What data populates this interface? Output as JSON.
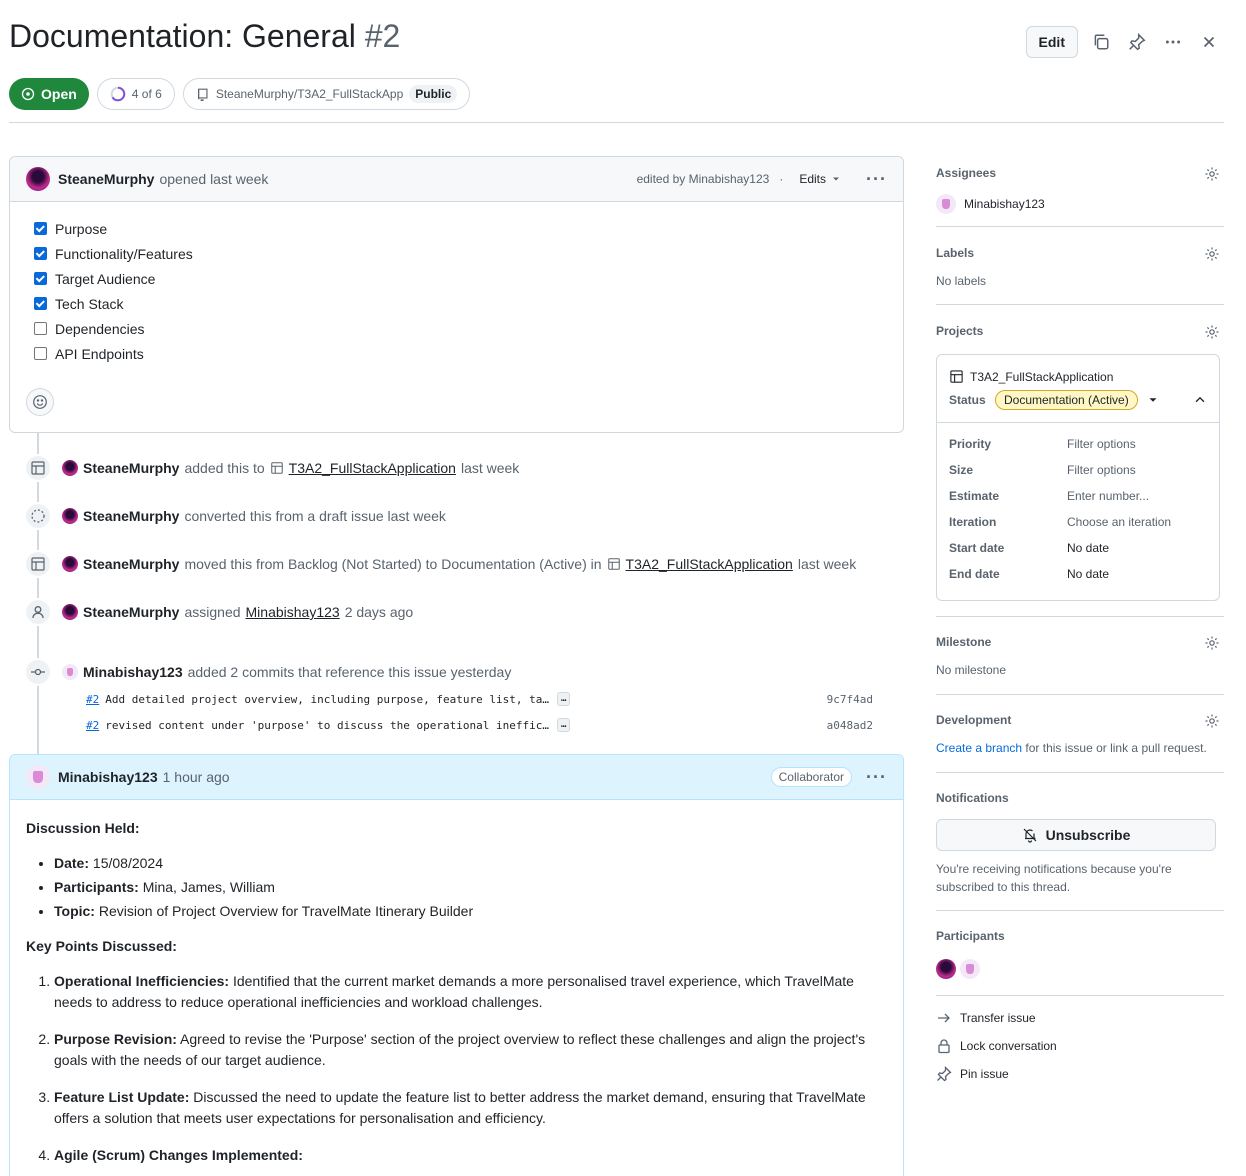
{
  "header": {
    "title": "Documentation: General",
    "number": "#2",
    "edit_label": "Edit",
    "state_label": "Open",
    "progress_label": "4 of 6",
    "progress_fraction": 0.6667,
    "repo_label": "SteaneMurphy/T3A2_FullStackApp",
    "repo_visibility": "Public"
  },
  "opening_comment": {
    "author": "SteaneMurphy",
    "time": "opened last week",
    "edited_by": "edited by Minabishay123",
    "separator": "·",
    "edits_label": "Edits",
    "tasks": [
      {
        "label": "Purpose",
        "checked": true
      },
      {
        "label": "Functionality/Features",
        "checked": true
      },
      {
        "label": "Target Audience",
        "checked": true
      },
      {
        "label": "Tech Stack",
        "checked": true
      },
      {
        "label": "Dependencies",
        "checked": false
      },
      {
        "label": "API Endpoints",
        "checked": false
      }
    ]
  },
  "timeline": [
    {
      "actor": "SteaneMurphy",
      "text": "added this to",
      "project": "T3A2_FullStackApplication",
      "time": "last week"
    },
    {
      "actor": "SteaneMurphy",
      "text": "converted this from a draft issue last week"
    },
    {
      "actor": "SteaneMurphy",
      "text": "moved this from Backlog (Not Started) to Documentation (Active) in",
      "project": "T3A2_FullStackApplication",
      "time": "last week"
    },
    {
      "actor": "SteaneMurphy",
      "text": "assigned",
      "assignee": "Minabishay123",
      "time": "2 days ago"
    },
    {
      "actor": "Minabishay123",
      "text": "added 2 commits that reference this issue yesterday"
    }
  ],
  "commits": [
    {
      "ref": "#2",
      "message": "Add detailed project overview, including purpose, feature list, ta…",
      "ellipsis": "…",
      "sha": "9c7f4ad"
    },
    {
      "ref": "#2",
      "message": "revised content under 'purpose' to discuss the operational ineffic…",
      "ellipsis": "…",
      "sha": "a048ad2"
    }
  ],
  "second_comment": {
    "author": "Minabishay123",
    "time": "1 hour ago",
    "role": "Collaborator",
    "heading1": "Discussion Held:",
    "details": [
      {
        "label": "Date:",
        "value": "15/08/2024"
      },
      {
        "label": "Participants:",
        "value": "Mina, James, William"
      },
      {
        "label": "Topic:",
        "value": "Revision of Project Overview for TravelMate Itinerary Builder"
      }
    ],
    "heading2": "Key Points Discussed:",
    "points": [
      {
        "label": "Operational Inefficiencies:",
        "value": "Identified that the current market demands a more personalised travel experience, which TravelMate needs to address to reduce operational inefficiencies and workload challenges."
      },
      {
        "label": "Purpose Revision:",
        "value": "Agreed to revise the 'Purpose' section of the project overview to reflect these challenges and align the project's goals with the needs of our target audience."
      },
      {
        "label": "Feature List Update:",
        "value": "Discussed the need to update the feature list to better address the market demand, ensuring that TravelMate offers a solution that meets user expectations for personalisation and efficiency."
      },
      {
        "label": "Agile (Scrum) Changes Implemented:",
        "value": ""
      }
    ]
  },
  "sidebar": {
    "assignees_title": "Assignees",
    "assignee": "Minabishay123",
    "labels_title": "Labels",
    "labels_value": "No labels",
    "projects_title": "Projects",
    "project_name": "T3A2_FullStackApplication",
    "status_label": "Status",
    "status_value": "Documentation (Active)",
    "fields": [
      {
        "key": "Priority",
        "value": "Filter options"
      },
      {
        "key": "Size",
        "value": "Filter options"
      },
      {
        "key": "Estimate",
        "value": "Enter number..."
      },
      {
        "key": "Iteration",
        "value": "Choose an iteration"
      },
      {
        "key": "Start date",
        "value": "No date"
      },
      {
        "key": "End date",
        "value": "No date"
      }
    ],
    "milestone_title": "Milestone",
    "milestone_value": "No milestone",
    "development_title": "Development",
    "dev_link": "Create a branch",
    "dev_text": " for this issue or link a pull request.",
    "notifications_title": "Notifications",
    "unsubscribe_label": "Unsubscribe",
    "notif_text": "You're receiving notifications because you're subscribed to this thread.",
    "participants_title": "Participants",
    "actions": [
      "Transfer issue",
      "Lock conversation",
      "Pin issue"
    ]
  },
  "colors": {
    "open_green": "#1f883d",
    "link_blue": "#0969da",
    "status_yellow": "#fff8c5"
  }
}
